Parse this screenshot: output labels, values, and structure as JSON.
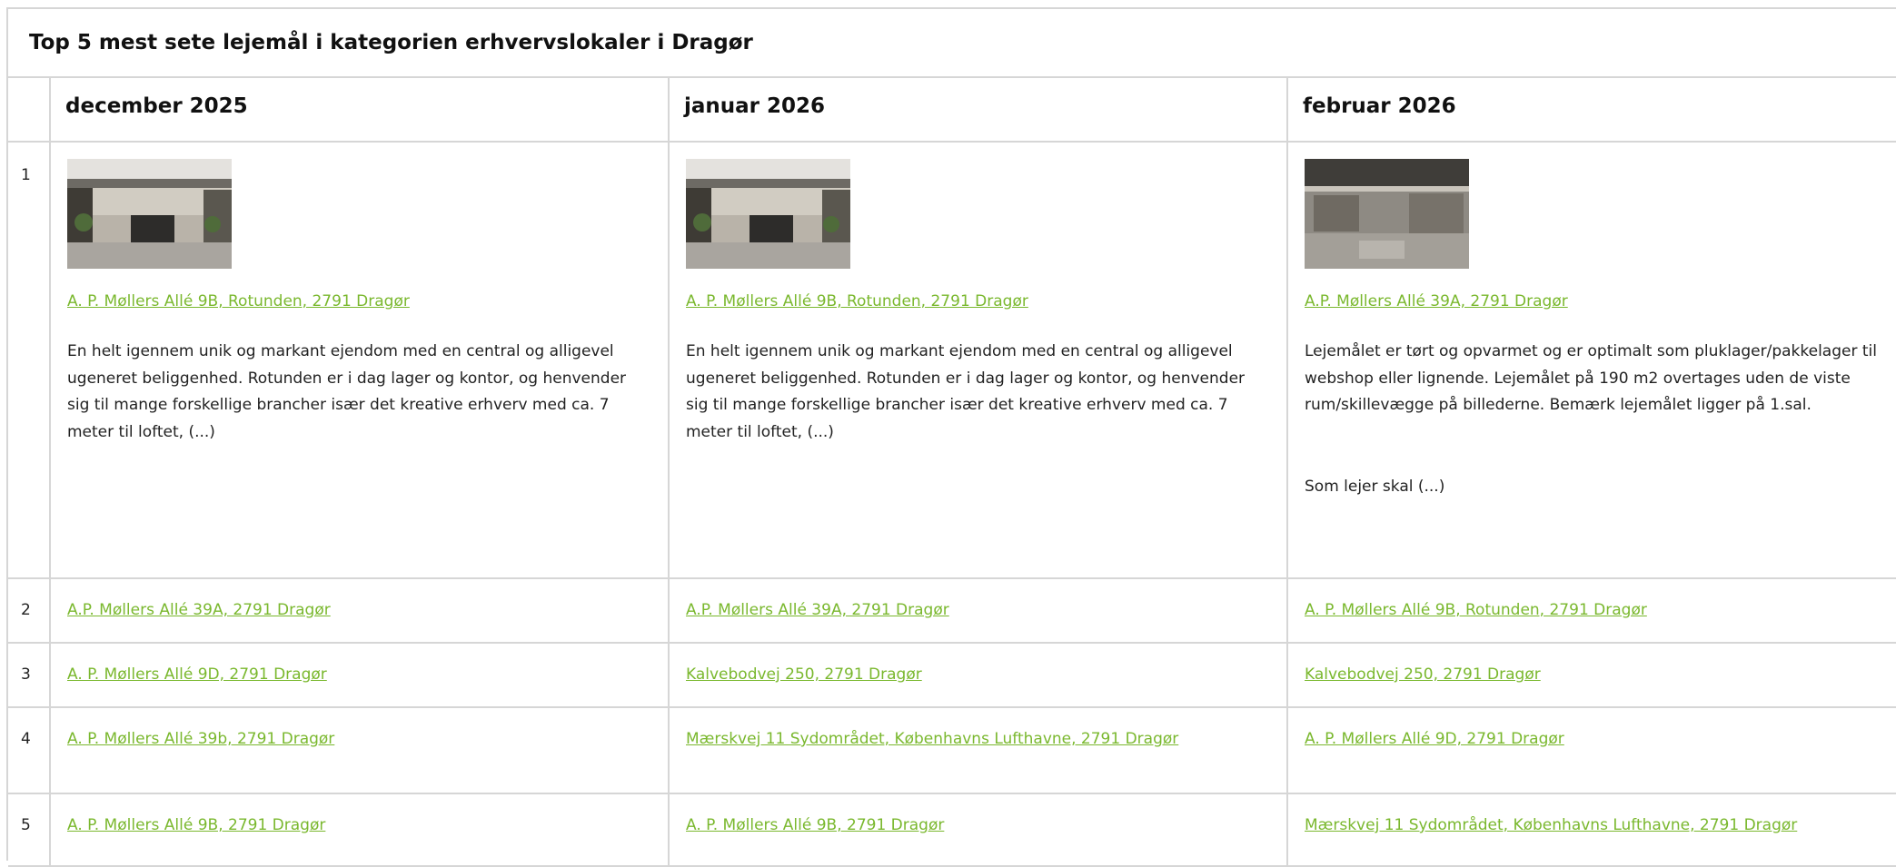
{
  "table_title": "Top 5 mest sete lejemål i kategorien erhvervslokaler i Dragør",
  "months": [
    "december 2025",
    "januar 2026",
    "februar 2026"
  ],
  "rows": [
    {
      "rank": "1",
      "cells": [
        {
          "address": "A. P. Møllers Allé 9B, Rotunden, 2791 Dragør",
          "image": "atrium-office-photo",
          "description": "En helt igennem unik og markant ejendom med en central og alligevel ugeneret beliggenhed. Rotunden er i dag lager og kontor, og henvender sig til mange forskellige brancher især det kreative erhverv med ca. 7 meter til loftet, (...)"
        },
        {
          "address": "A. P. Møllers Allé 9B, Rotunden, 2791 Dragør",
          "image": "atrium-office-photo",
          "description": "En helt igennem unik og markant ejendom med en central og alligevel ugeneret beliggenhed. Rotunden er i dag lager og kontor, og henvender sig til mange forskellige brancher især det kreative erhverv med ca. 7 meter til loftet, (...)"
        },
        {
          "address": "A.P. Møllers Allé 39A, 2791 Dragør",
          "image": "warehouse-interior-photo",
          "description": "Lejemålet er tørt og opvarmet og er optimalt som pluklager/pakkelager til webshop eller lignende. Lejemålet på 190 m2 overtages uden de viste rum/skillevægge på billederne. Bemærk lejemålet ligger på 1.sal.",
          "description_extra": "Som lejer skal (...)"
        }
      ]
    },
    {
      "rank": "2",
      "cells": [
        "A.P. Møllers Allé 39A, 2791 Dragør",
        "A.P. Møllers Allé 39A, 2791 Dragør",
        "A. P. Møllers Allé 9B, Rotunden, 2791 Dragør"
      ]
    },
    {
      "rank": "3",
      "cells": [
        "A. P. Møllers Allé 9D, 2791 Dragør",
        "Kalvebodvej 250, 2791 Dragør",
        "Kalvebodvej 250, 2791 Dragør"
      ]
    },
    {
      "rank": "4",
      "cells": [
        "A. P. Møllers Allé 39b, 2791 Dragør",
        "Mærskvej 11 Sydområdet, Københavns Lufthavne, 2791 Dragør",
        "A. P. Møllers Allé 9D, 2791 Dragør"
      ]
    },
    {
      "rank": "5",
      "cells": [
        "A. P. Møllers Allé 9B, 2791 Dragør",
        "A. P. Møllers Allé 9B, 2791 Dragør",
        "Mærskvej 11 Sydområdet, Københavns Lufthavne, 2791 Dragør"
      ]
    }
  ],
  "colors": {
    "link": "#7ab82e",
    "border": "#d6d6d6",
    "text": "#222222"
  }
}
